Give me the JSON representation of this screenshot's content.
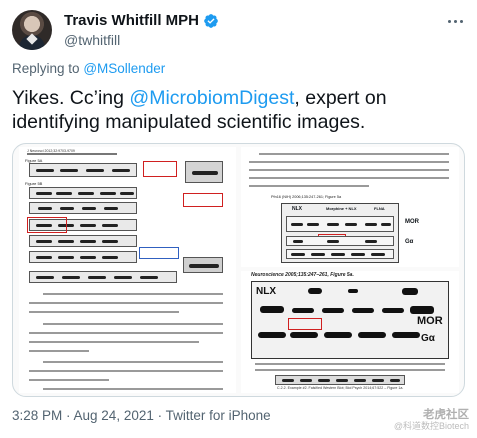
{
  "author": {
    "display_name": "Travis Whitfill MPH",
    "handle": "@twhitfill"
  },
  "reply": {
    "prefix": "Replying to",
    "target": "@MSollender"
  },
  "tweet": {
    "text_before": "Yikes. Cc’ing ",
    "mention": "@MicrobiomDigest",
    "text_after": ", expert on identifying manipulated scientific images."
  },
  "media": {
    "left_header": "J Neurosci 2012;32:9703-9709",
    "fig_label_a": "Figure 5A",
    "fig_label_b": "Figure 5B",
    "right_top_header": "Pfn16 (NIH) 2006;135:247-261; Figure 5a",
    "right_top_labels": [
      "NLX",
      "Morphine + NLX",
      "FLNA",
      "MOR",
      "Gα"
    ],
    "right_bottom_header": "Neuroscience 2005;135:247–261, Figure 5a.",
    "right_bottom_labels": {
      "nlx": "NLX",
      "mor": "MOR",
      "ga": "Gα"
    },
    "right_bottom_caption": "C.2.2. Example #2. Falsified Western Blot; Biol Psych 2014;67:522 – Figure 1a."
  },
  "footer": {
    "time": "3:28 PM · Aug 24, 2021 · Twitter for iPhone"
  },
  "watermark": {
    "main": "老虎社区",
    "sub": "@科道数控Biotech"
  },
  "colors": {
    "link": "#1d9bf0",
    "secondary_text": "#536471",
    "verified": "#1d9bf0"
  }
}
